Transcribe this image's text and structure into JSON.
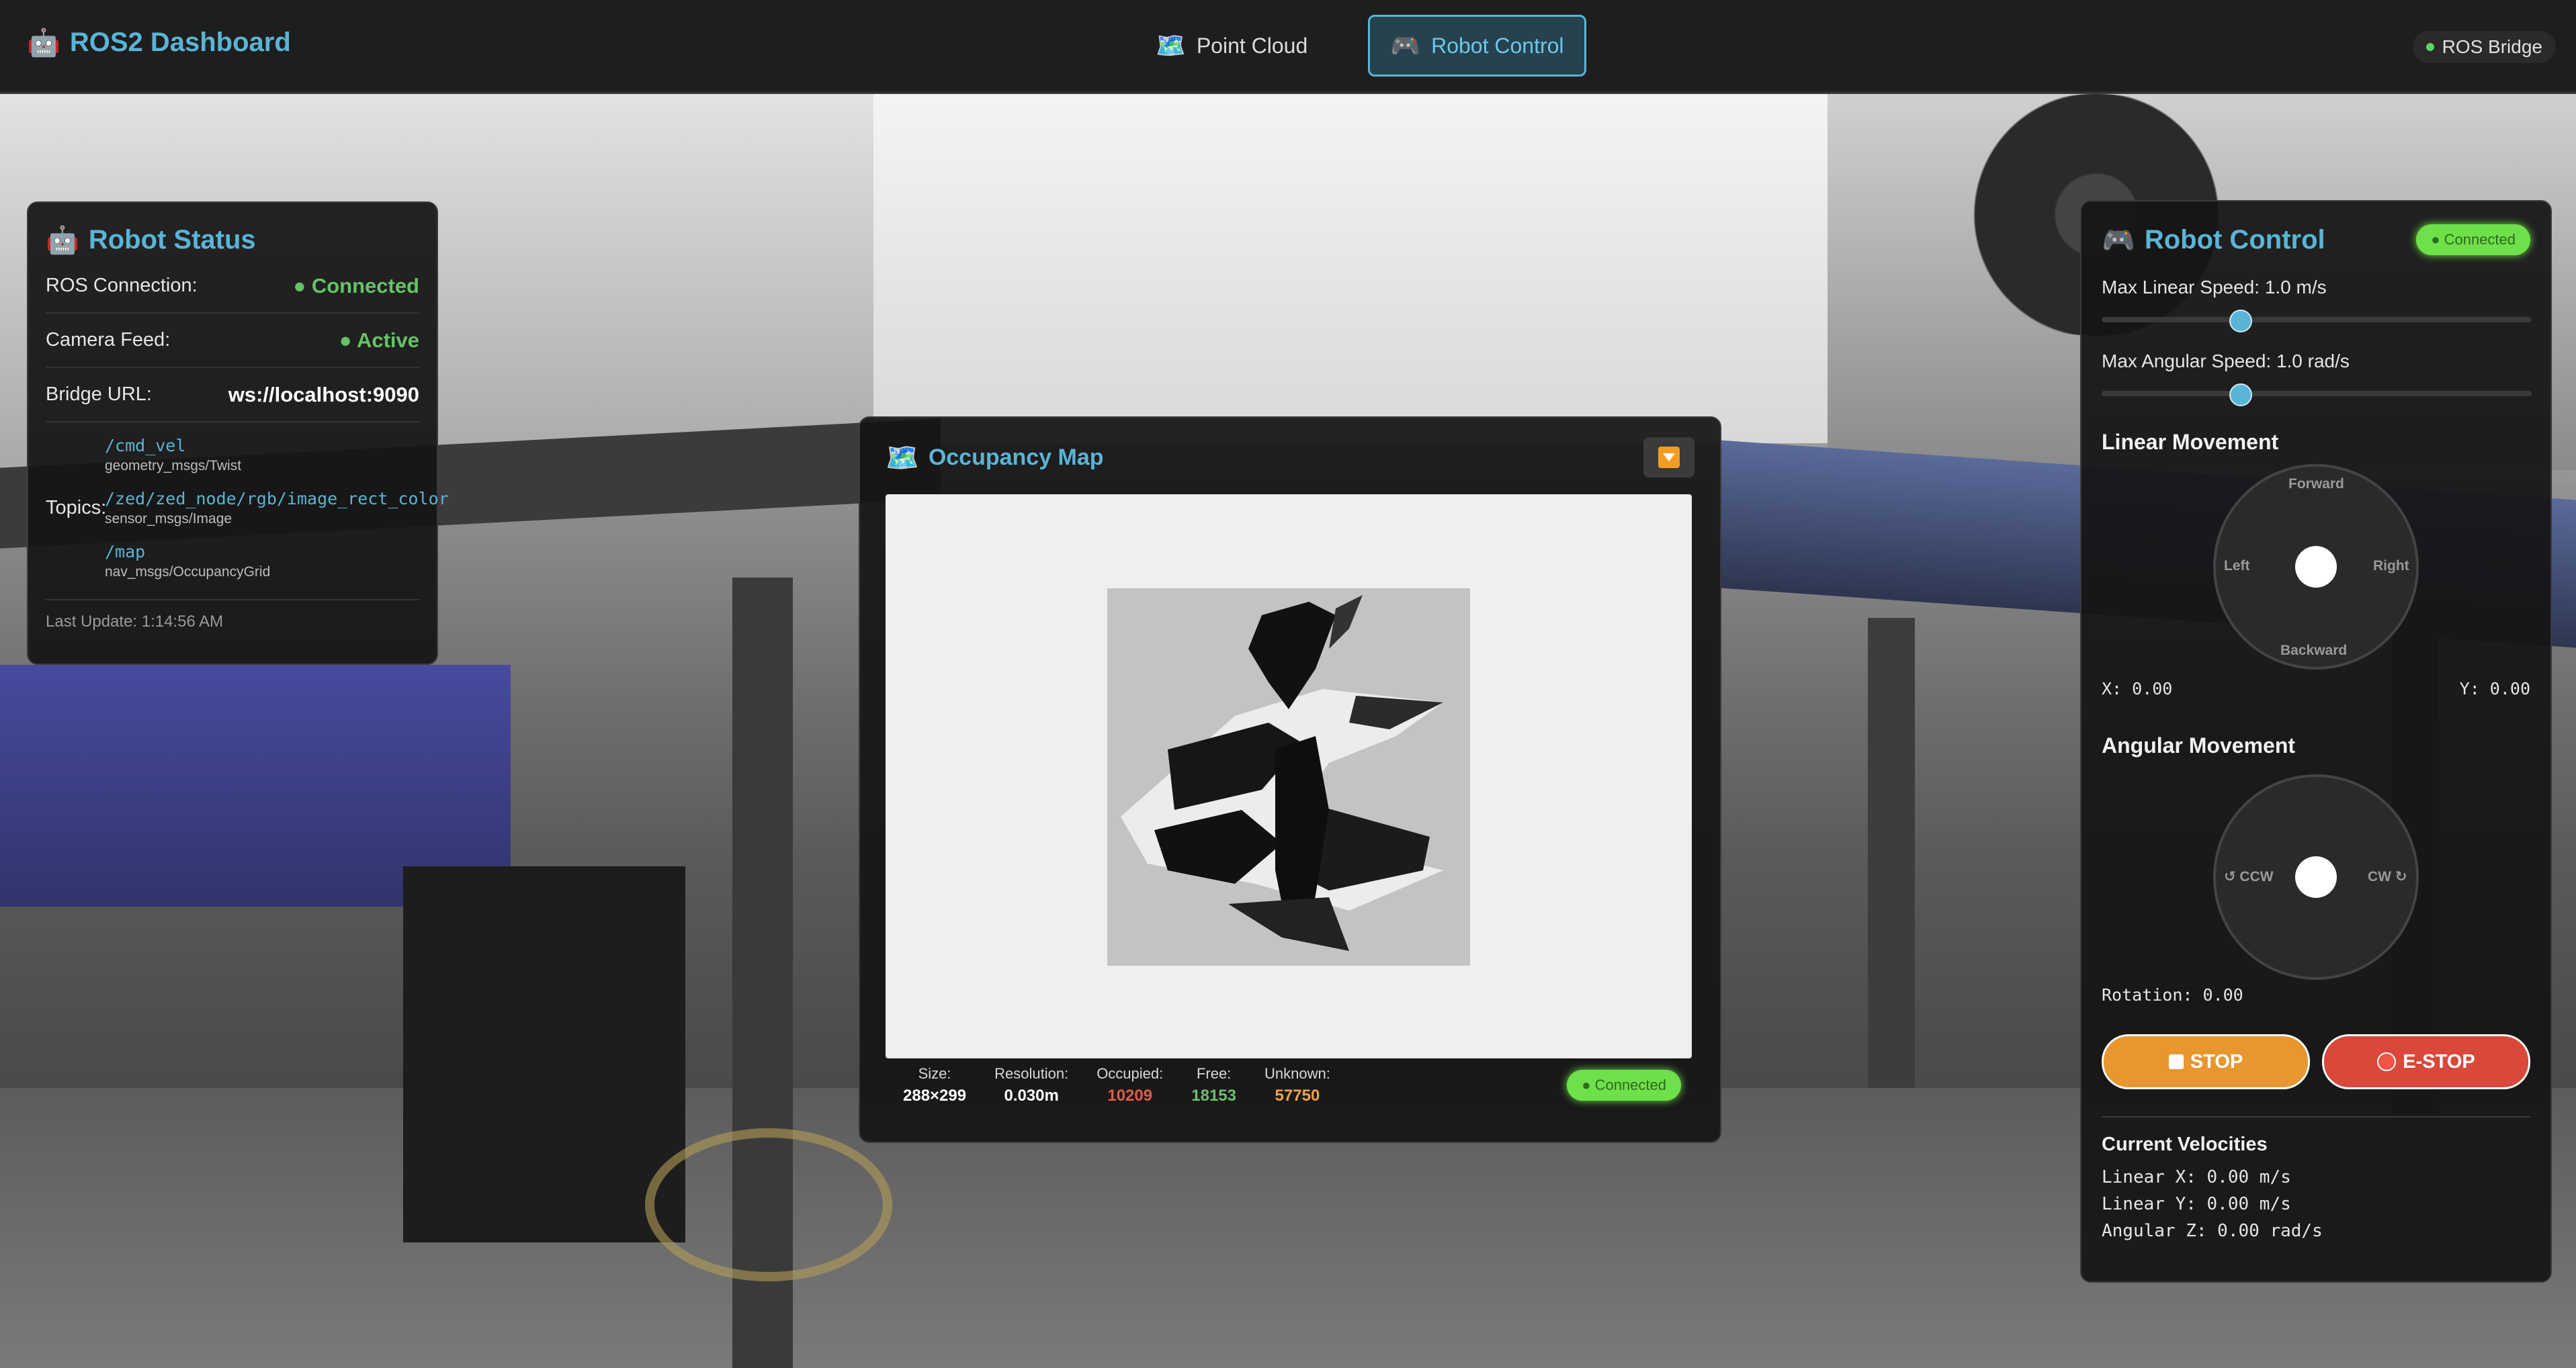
{
  "header": {
    "title": "ROS2 Dashboard",
    "tabs": [
      {
        "label": "Point Cloud",
        "icon": "map-icon",
        "active": false
      },
      {
        "label": "Robot Control",
        "icon": "gamepad-icon",
        "active": true
      }
    ],
    "bridge_badge": "ROS Bridge"
  },
  "status": {
    "title": "Robot Status",
    "rows": [
      {
        "label": "ROS Connection:",
        "value": "● Connected"
      },
      {
        "label": "Camera Feed:",
        "value": "● Active"
      },
      {
        "label": "Bridge URL:",
        "value": "ws://localhost:9090"
      }
    ],
    "topics_label": "Topics:",
    "topics": [
      {
        "name": "/cmd_vel",
        "type": "geometry_msgs/Twist"
      },
      {
        "name": "/zed/zed_node/rgb/image_rect_color",
        "type": "sensor_msgs/Image"
      },
      {
        "name": "/map",
        "type": "nav_msgs/OccupancyGrid"
      }
    ],
    "last_update": "Last Update: 1:14:56 AM"
  },
  "map": {
    "title": "Occupancy Map",
    "stats": [
      {
        "label": "Size:",
        "value": "288×299"
      },
      {
        "label": "Resolution:",
        "value": "0.030m"
      },
      {
        "label": "Occupied:",
        "value": "10209"
      },
      {
        "label": "Free:",
        "value": "18153"
      },
      {
        "label": "Unknown:",
        "value": "57750"
      }
    ],
    "status": "● Connected"
  },
  "control": {
    "title": "Robot Control",
    "status": "● Connected",
    "max_linear": "Max Linear Speed: 1.0 m/s",
    "max_angular": "Max Angular Speed: 1.0 rad/s",
    "max_linear_fraction": 0.32,
    "max_angular_fraction": 0.32,
    "linear_title": "Linear Movement",
    "linear_labels": {
      "forward": "Forward",
      "backward": "Backward",
      "left": "Left",
      "right": "Right"
    },
    "x_readout": "X: 0.00",
    "y_readout": "Y: 0.00",
    "angular_title": "Angular Movement",
    "angular_labels": {
      "ccw": "↺ CCW",
      "cw": "CW ↻"
    },
    "rotation_readout": "Rotation: 0.00",
    "stop_label": "STOP",
    "estop_label": "E-STOP",
    "velocities_title": "Current Velocities",
    "velocities": [
      "Linear X: 0.00 m/s",
      "Linear Y: 0.00 m/s",
      "Angular Z: 0.00 rad/s"
    ]
  },
  "colors": {
    "accent": "#5ab4d6",
    "connected_green": "#6ee04a",
    "stop_orange": "#e8962f",
    "estop_red": "#d9483a"
  }
}
